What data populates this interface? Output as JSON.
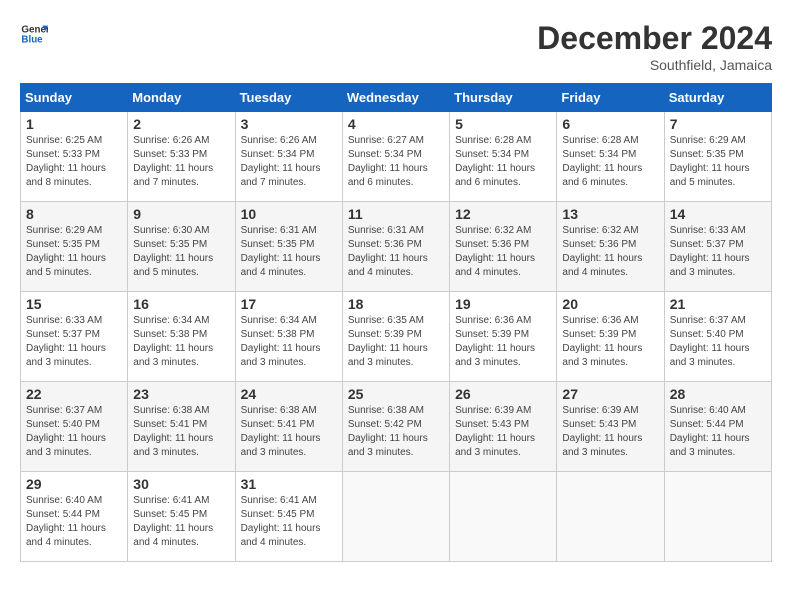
{
  "header": {
    "logo_line1": "General",
    "logo_line2": "Blue",
    "month": "December 2024",
    "location": "Southfield, Jamaica"
  },
  "weekdays": [
    "Sunday",
    "Monday",
    "Tuesday",
    "Wednesday",
    "Thursday",
    "Friday",
    "Saturday"
  ],
  "weeks": [
    [
      {
        "day": "1",
        "sunrise": "6:25 AM",
        "sunset": "5:33 PM",
        "daylight": "11 hours and 8 minutes."
      },
      {
        "day": "2",
        "sunrise": "6:26 AM",
        "sunset": "5:33 PM",
        "daylight": "11 hours and 7 minutes."
      },
      {
        "day": "3",
        "sunrise": "6:26 AM",
        "sunset": "5:34 PM",
        "daylight": "11 hours and 7 minutes."
      },
      {
        "day": "4",
        "sunrise": "6:27 AM",
        "sunset": "5:34 PM",
        "daylight": "11 hours and 6 minutes."
      },
      {
        "day": "5",
        "sunrise": "6:28 AM",
        "sunset": "5:34 PM",
        "daylight": "11 hours and 6 minutes."
      },
      {
        "day": "6",
        "sunrise": "6:28 AM",
        "sunset": "5:34 PM",
        "daylight": "11 hours and 6 minutes."
      },
      {
        "day": "7",
        "sunrise": "6:29 AM",
        "sunset": "5:35 PM",
        "daylight": "11 hours and 5 minutes."
      }
    ],
    [
      {
        "day": "8",
        "sunrise": "6:29 AM",
        "sunset": "5:35 PM",
        "daylight": "11 hours and 5 minutes."
      },
      {
        "day": "9",
        "sunrise": "6:30 AM",
        "sunset": "5:35 PM",
        "daylight": "11 hours and 5 minutes."
      },
      {
        "day": "10",
        "sunrise": "6:31 AM",
        "sunset": "5:35 PM",
        "daylight": "11 hours and 4 minutes."
      },
      {
        "day": "11",
        "sunrise": "6:31 AM",
        "sunset": "5:36 PM",
        "daylight": "11 hours and 4 minutes."
      },
      {
        "day": "12",
        "sunrise": "6:32 AM",
        "sunset": "5:36 PM",
        "daylight": "11 hours and 4 minutes."
      },
      {
        "day": "13",
        "sunrise": "6:32 AM",
        "sunset": "5:36 PM",
        "daylight": "11 hours and 4 minutes."
      },
      {
        "day": "14",
        "sunrise": "6:33 AM",
        "sunset": "5:37 PM",
        "daylight": "11 hours and 3 minutes."
      }
    ],
    [
      {
        "day": "15",
        "sunrise": "6:33 AM",
        "sunset": "5:37 PM",
        "daylight": "11 hours and 3 minutes."
      },
      {
        "day": "16",
        "sunrise": "6:34 AM",
        "sunset": "5:38 PM",
        "daylight": "11 hours and 3 minutes."
      },
      {
        "day": "17",
        "sunrise": "6:34 AM",
        "sunset": "5:38 PM",
        "daylight": "11 hours and 3 minutes."
      },
      {
        "day": "18",
        "sunrise": "6:35 AM",
        "sunset": "5:39 PM",
        "daylight": "11 hours and 3 minutes."
      },
      {
        "day": "19",
        "sunrise": "6:36 AM",
        "sunset": "5:39 PM",
        "daylight": "11 hours and 3 minutes."
      },
      {
        "day": "20",
        "sunrise": "6:36 AM",
        "sunset": "5:39 PM",
        "daylight": "11 hours and 3 minutes."
      },
      {
        "day": "21",
        "sunrise": "6:37 AM",
        "sunset": "5:40 PM",
        "daylight": "11 hours and 3 minutes."
      }
    ],
    [
      {
        "day": "22",
        "sunrise": "6:37 AM",
        "sunset": "5:40 PM",
        "daylight": "11 hours and 3 minutes."
      },
      {
        "day": "23",
        "sunrise": "6:38 AM",
        "sunset": "5:41 PM",
        "daylight": "11 hours and 3 minutes."
      },
      {
        "day": "24",
        "sunrise": "6:38 AM",
        "sunset": "5:41 PM",
        "daylight": "11 hours and 3 minutes."
      },
      {
        "day": "25",
        "sunrise": "6:38 AM",
        "sunset": "5:42 PM",
        "daylight": "11 hours and 3 minutes."
      },
      {
        "day": "26",
        "sunrise": "6:39 AM",
        "sunset": "5:43 PM",
        "daylight": "11 hours and 3 minutes."
      },
      {
        "day": "27",
        "sunrise": "6:39 AM",
        "sunset": "5:43 PM",
        "daylight": "11 hours and 3 minutes."
      },
      {
        "day": "28",
        "sunrise": "6:40 AM",
        "sunset": "5:44 PM",
        "daylight": "11 hours and 3 minutes."
      }
    ],
    [
      {
        "day": "29",
        "sunrise": "6:40 AM",
        "sunset": "5:44 PM",
        "daylight": "11 hours and 4 minutes."
      },
      {
        "day": "30",
        "sunrise": "6:41 AM",
        "sunset": "5:45 PM",
        "daylight": "11 hours and 4 minutes."
      },
      {
        "day": "31",
        "sunrise": "6:41 AM",
        "sunset": "5:45 PM",
        "daylight": "11 hours and 4 minutes."
      },
      null,
      null,
      null,
      null
    ]
  ]
}
